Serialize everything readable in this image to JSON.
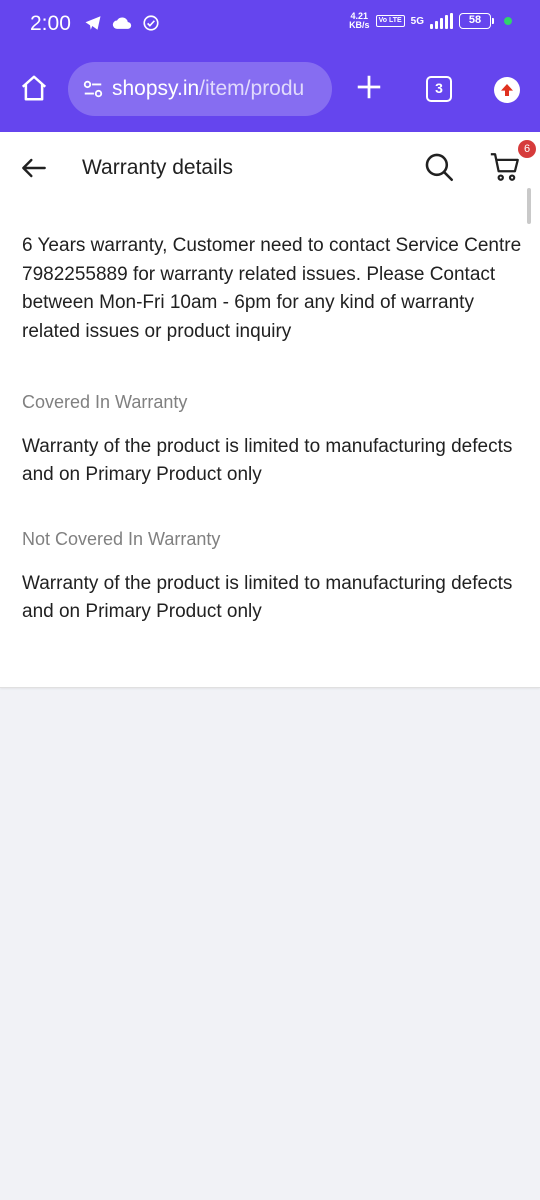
{
  "colors": {
    "brand_purple": "#6545ee",
    "badge_red": "#d63b3b",
    "label_gray": "#808080",
    "text_dark": "#212121",
    "page_bg": "#f1f2f6"
  },
  "status_bar": {
    "time": "2:00",
    "left_icons": [
      "telegram-icon",
      "cloud-icon",
      "check-circle-icon"
    ],
    "speed_value": "4.21",
    "speed_unit": "KB/s",
    "volte": "Vo LTE",
    "network": "5G",
    "battery": "58"
  },
  "browser": {
    "url_domain": "shopsy.in",
    "url_path": "/item/produ",
    "tab_count": "3",
    "icons": [
      "home-icon",
      "site-settings-icon",
      "plus-icon",
      "tabs-icon",
      "update-icon"
    ]
  },
  "header": {
    "title": "Warranty details",
    "cart_count": "6",
    "icons": [
      "back-arrow-icon",
      "search-icon",
      "cart-icon"
    ]
  },
  "warranty": {
    "description": "6 Years warranty, Customer need to contact Service Centre 7982255889 for warranty related issues. Please Contact between Mon-Fri 10am - 6pm for any kind of warranty related issues or product inquiry",
    "covered_label": "Covered In Warranty",
    "covered_text": "Warranty of the product is limited to manufacturing defects and on Primary Product only",
    "not_covered_label": "Not Covered In Warranty",
    "not_covered_text": "Warranty of the product is limited to manufacturing defects and on Primary Product only"
  }
}
